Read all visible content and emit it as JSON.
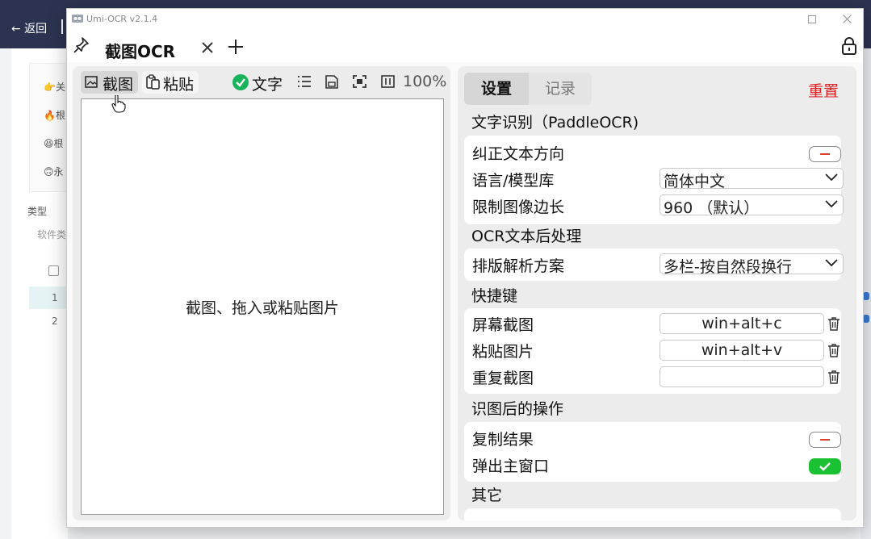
{
  "background": {
    "back_label": "← 返回",
    "items": [
      "👉关",
      "🔥根",
      "😆根",
      "🙃永"
    ],
    "type_label": "类型",
    "filter_placeholder": "软件类",
    "rows": [
      "1",
      "2"
    ]
  },
  "window": {
    "title": "Umi-OCR v2.1.4",
    "tab_label": "截图OCR"
  },
  "toolbar": {
    "screenshot_label": "截图",
    "paste_label": "粘贴",
    "text_toggle_label": "文字",
    "zoom": "100%"
  },
  "canvas": {
    "hint": "截图、拖入或粘贴图片"
  },
  "settings": {
    "tab_settings": "设置",
    "tab_records": "记录",
    "reset_label": "重置",
    "sections": {
      "ocr_title": "文字识别（PaddleOCR)",
      "post_title": "OCR文本后处理",
      "hotkey_title": "快捷键",
      "after_title": "识图后的操作",
      "other_title": "其它"
    },
    "ocr": {
      "correct_direction_label": "纠正文本方向",
      "correct_direction_enabled": false,
      "language_label": "语言/模型库",
      "language_value": "简体中文",
      "limit_label": "限制图像边长",
      "limit_value": "960 （默认）"
    },
    "post": {
      "layout_label": "排版解析方案",
      "layout_value": "多栏-按自然段换行"
    },
    "hotkeys": {
      "screenshot_label": "屏幕截图",
      "screenshot_value": "win+alt+c",
      "paste_label": "粘贴图片",
      "paste_value": "win+alt+v",
      "repeat_label": "重复截图",
      "repeat_value": ""
    },
    "after": {
      "copy_label": "复制结果",
      "copy_enabled": false,
      "popup_label": "弹出主窗口",
      "popup_enabled": true
    }
  },
  "colors": {
    "accent_green": "#1ac133",
    "reset_red": "#e02020",
    "check_green": "#18b45b"
  }
}
